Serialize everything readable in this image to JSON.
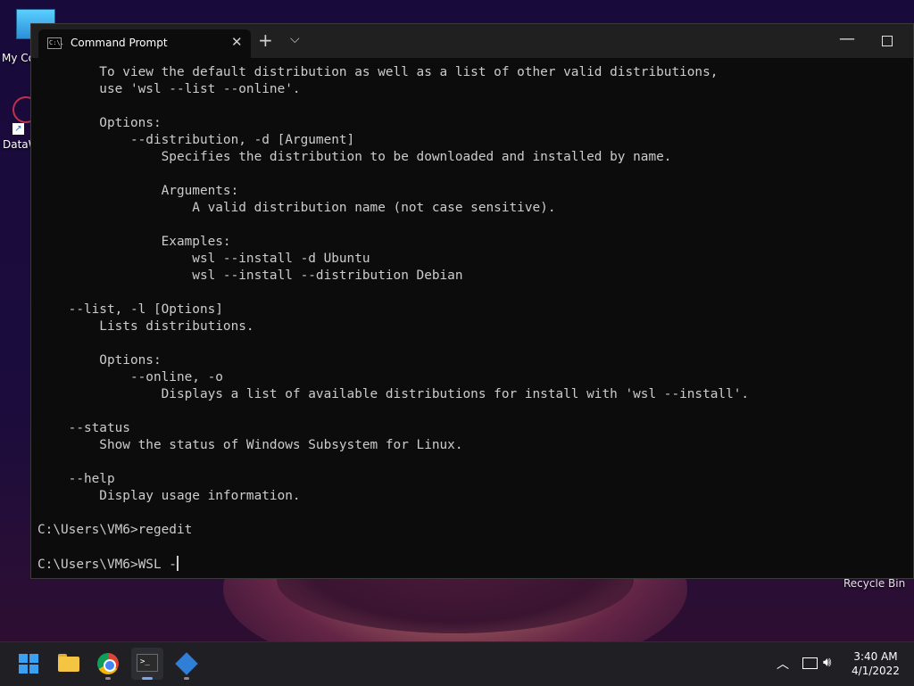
{
  "desktop": {
    "icons": [
      {
        "label": "My Co"
      },
      {
        "label": "DataW"
      }
    ],
    "recycle_bin_label": "Recycle Bin"
  },
  "window": {
    "tab_title": "Command Prompt",
    "tab_icon_text": "C:\\.",
    "close_tab_glyph": "✕",
    "new_tab_glyph": "+",
    "dropdown_glyph": "⌵",
    "minimize_glyph": "—"
  },
  "console": {
    "lines": [
      "        To view the default distribution as well as a list of other valid distributions,",
      "        use 'wsl --list --online'.",
      "",
      "        Options:",
      "            --distribution, -d [Argument]",
      "                Specifies the distribution to be downloaded and installed by name.",
      "",
      "                Arguments:",
      "                    A valid distribution name (not case sensitive).",
      "",
      "                Examples:",
      "                    wsl --install -d Ubuntu",
      "                    wsl --install --distribution Debian",
      "",
      "    --list, -l [Options]",
      "        Lists distributions.",
      "",
      "        Options:",
      "            --online, -o",
      "                Displays a list of available distributions for install with 'wsl --install'.",
      "",
      "    --status",
      "        Show the status of Windows Subsystem for Linux.",
      "",
      "    --help",
      "        Display usage information.",
      "",
      "C:\\Users\\VM6>regedit",
      ""
    ],
    "current_prompt": "C:\\Users\\VM6>WSL -"
  },
  "taskbar": {
    "apps": [
      {
        "name": "Start"
      },
      {
        "name": "File Explorer"
      },
      {
        "name": "Google Chrome"
      },
      {
        "name": "Windows Terminal",
        "active": true
      },
      {
        "name": "DataWarrior"
      }
    ],
    "tray": {
      "chevron_glyph": "︿",
      "volume_glyph": "🔊︎"
    },
    "clock": {
      "time": "3:40 AM",
      "date": "4/1/2022"
    }
  }
}
